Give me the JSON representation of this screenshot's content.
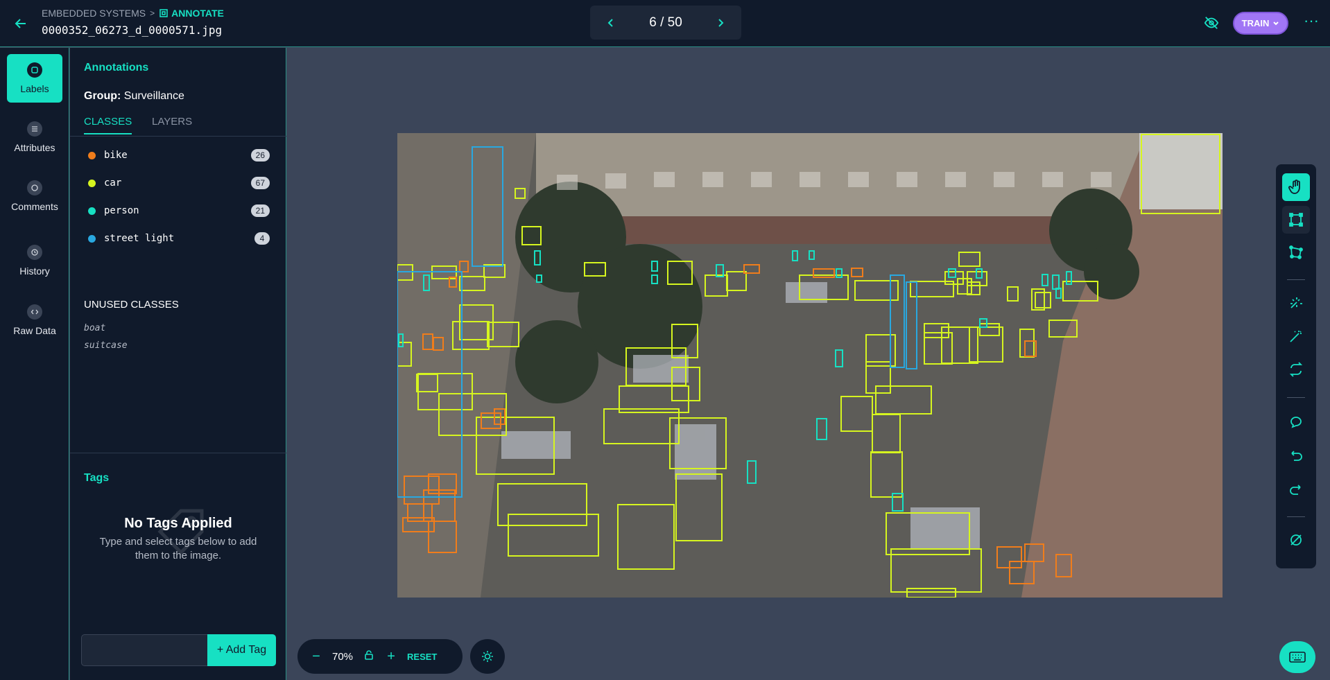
{
  "header": {
    "breadcrumb_project": "EMBEDDED SYSTEMS",
    "breadcrumb_separator": ">",
    "breadcrumb_current": "ANNOTATE",
    "filename": "0000352_06273_d_0000571.jpg",
    "pager": "6 / 50",
    "train_label": "TRAIN",
    "more_label": "···"
  },
  "nav": {
    "items": [
      {
        "label": "Labels"
      },
      {
        "label": "Attributes"
      },
      {
        "label": "Comments"
      },
      {
        "label": "History"
      },
      {
        "label": "Raw Data"
      }
    ]
  },
  "panel": {
    "title": "Annotations",
    "group_label": "Group:",
    "group_value": "Surveillance",
    "tabs": [
      {
        "label": "CLASSES"
      },
      {
        "label": "LAYERS"
      }
    ],
    "classes": [
      {
        "name": "bike",
        "count": "26",
        "color": "#f07d1b"
      },
      {
        "name": "car",
        "count": "67",
        "color": "#d6f51f"
      },
      {
        "name": "person",
        "count": "21",
        "color": "#17e0c3"
      },
      {
        "name": "street light",
        "count": "4",
        "color": "#29a8e0"
      }
    ],
    "unused_title": "UNUSED CLASSES",
    "unused": [
      "boat",
      "suitcase"
    ]
  },
  "tags": {
    "title": "Tags",
    "empty_title": "No Tags Applied",
    "empty_sub": "Type and select tags below to add them to the image.",
    "input_value": "",
    "add_label": "+ Add Tag"
  },
  "zoom": {
    "value": "70%",
    "reset_label": "RESET"
  },
  "colors": {
    "accent": "#17e0c3",
    "train": "#a176f5",
    "bike": "#f07d1b",
    "car": "#d6f51f",
    "person": "#17e0c3",
    "street_light": "#29a8e0"
  }
}
